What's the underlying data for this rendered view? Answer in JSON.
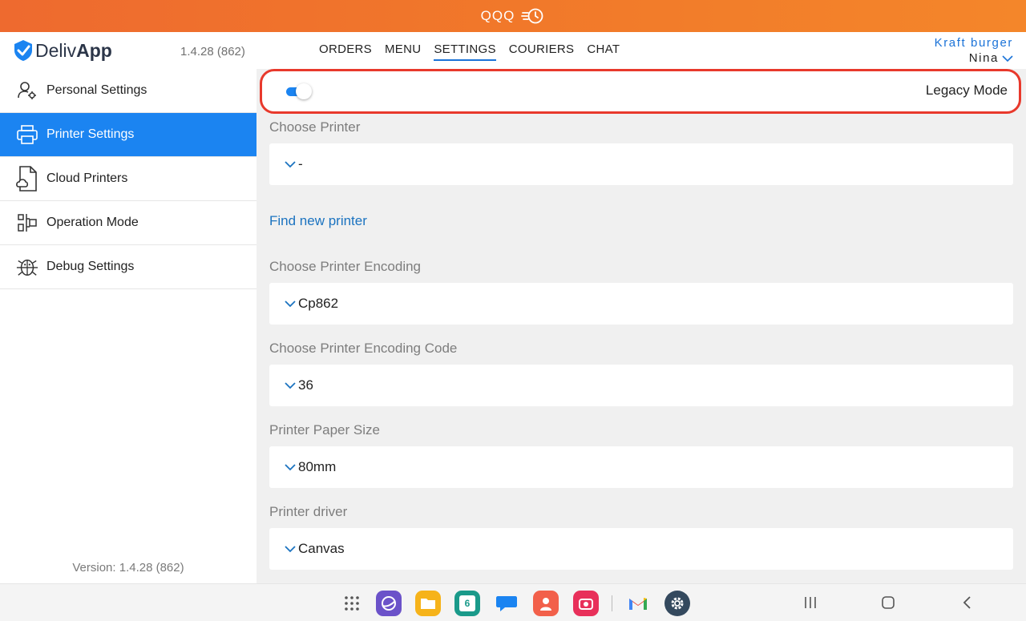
{
  "topbar": {
    "store_name": "QQQ"
  },
  "header": {
    "logo_prefix": "Deliv",
    "logo_bold": "App",
    "version": "1.4.28 (862)",
    "nav": [
      "ORDERS",
      "MENU",
      "SETTINGS",
      "COURIERS",
      "CHAT"
    ],
    "active_nav": "SETTINGS",
    "restaurant": "Kraft burger",
    "user": "Nina"
  },
  "sidebar": {
    "items": [
      {
        "label": "Personal Settings",
        "icon": "user-gear-icon"
      },
      {
        "label": "Printer Settings",
        "icon": "printer-icon"
      },
      {
        "label": "Cloud Printers",
        "icon": "cloud-document-icon"
      },
      {
        "label": "Operation Mode",
        "icon": "operation-mode-icon"
      },
      {
        "label": "Debug Settings",
        "icon": "bug-icon"
      }
    ],
    "active_index": 1,
    "version": "Version: 1.4.28 (862)"
  },
  "main": {
    "legacy_mode": {
      "label": "Legacy Mode",
      "enabled": true
    },
    "choose_printer": {
      "label": "Choose Printer",
      "value": "-"
    },
    "find_printer": "Find new printer",
    "encoding": {
      "label": "Choose Printer Encoding",
      "value": "Cp862"
    },
    "encoding_code": {
      "label": "Choose Printer Encoding Code",
      "value": "36"
    },
    "paper_size": {
      "label": "Printer Paper Size",
      "value": "80mm"
    },
    "driver": {
      "label": "Printer driver",
      "value": "Canvas"
    }
  },
  "colors": {
    "accent": "#1b84f1",
    "topbar": "#f1782a",
    "highlight": "#e8392c"
  },
  "dock": {
    "calendar_day": "6",
    "apps": [
      "app-drawer-icon",
      "internet-icon",
      "files-icon",
      "calendar-icon",
      "messages-icon",
      "contacts-icon",
      "camera-icon",
      "gmail-icon",
      "settings-icon"
    ],
    "system": [
      "recents-icon",
      "home-icon",
      "back-icon"
    ]
  }
}
